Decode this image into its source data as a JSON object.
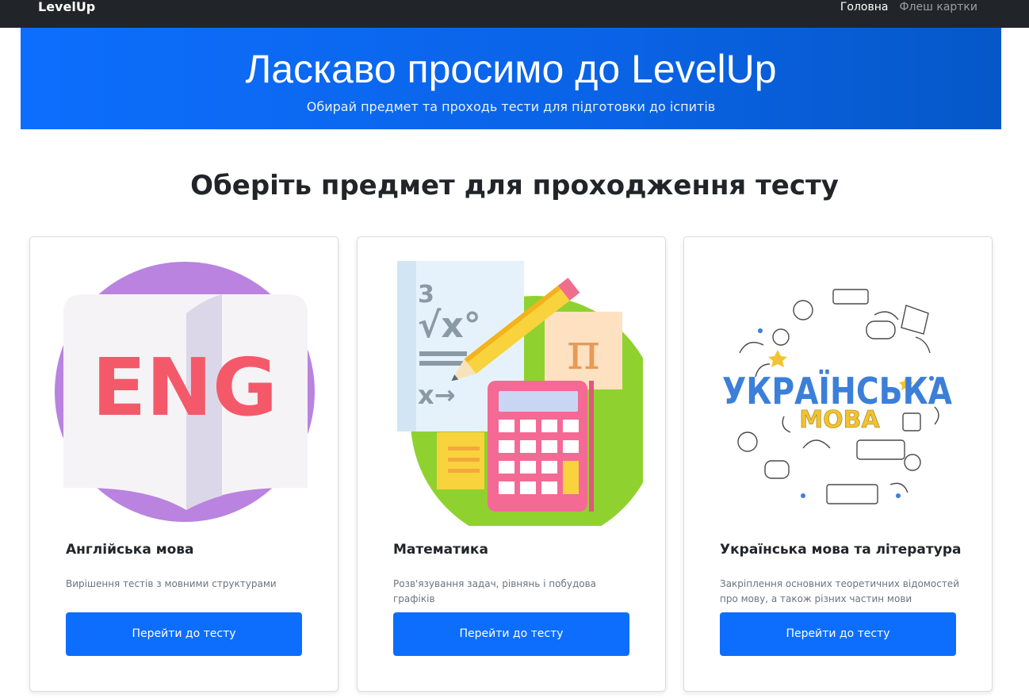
{
  "navbar": {
    "brand": "LevelUp",
    "links": [
      {
        "label": "Головна",
        "active": true
      },
      {
        "label": "Флеш картки",
        "active": false
      }
    ]
  },
  "hero": {
    "title": "Ласкаво просимо до LevelUp",
    "subtitle": "Обирай предмет та проходь тести для підготовки до іспитів"
  },
  "main": {
    "title": "Оберіть предмет для проходження тесту"
  },
  "cards": [
    {
      "title": "Англійська мова",
      "text": "Вирішення тестів з мовними структурами",
      "button": "Перейти до тесту",
      "image_text": "ENG",
      "icon": "english-book-icon"
    },
    {
      "title": "Математика",
      "text": "Розв'язування задач, рівнянь і побудова графіків",
      "button": "Перейти до тесту",
      "image_text": "π",
      "icon": "math-icon"
    },
    {
      "title": "Українська мова та література",
      "text": "Закріплення основних теоретичних відомостей про мову, а також різних частин мови",
      "button": "Перейти до тесту",
      "image_text": [
        "УКРАЇНСЬКА",
        "МОВА"
      ],
      "icon": "ukrainian-doodle-icon"
    }
  ],
  "colors": {
    "primary": "#0d6efd",
    "navbar": "#212529"
  }
}
